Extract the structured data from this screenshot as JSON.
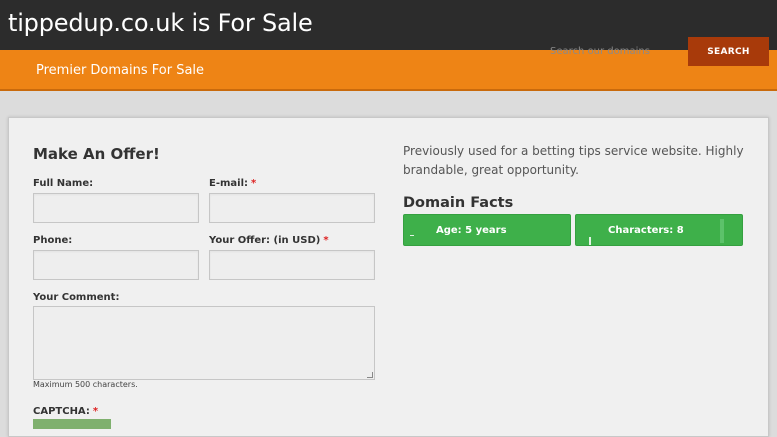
{
  "header": {
    "site_title": "tippedup.co.uk is For Sale",
    "tagline": "Premier Domains For Sale"
  },
  "search": {
    "placeholder": "Search our domains",
    "button_label": "SEARCH"
  },
  "offer_form": {
    "title": "Make An Offer!",
    "full_name_label": "Full Name:",
    "email_label": "E-mail:",
    "phone_label": "Phone:",
    "offer_label": "Your Offer: (in USD)",
    "comment_label": "Your Comment:",
    "comment_hint": "Maximum 500 characters.",
    "captcha_label": "CAPTCHA:",
    "required_marker": "*"
  },
  "domain_info": {
    "description": "Previously used for a betting tips service website. Highly brandable, great opportunity.",
    "facts_title": "Domain Facts",
    "facts": [
      {
        "label": "Age: 5 years"
      },
      {
        "label": "Characters: 8"
      }
    ]
  },
  "colors": {
    "topbar": "#2c2c2c",
    "accent_orange": "#ee8415",
    "search_button": "#a83a0a",
    "fact_green": "#3eb04a"
  }
}
